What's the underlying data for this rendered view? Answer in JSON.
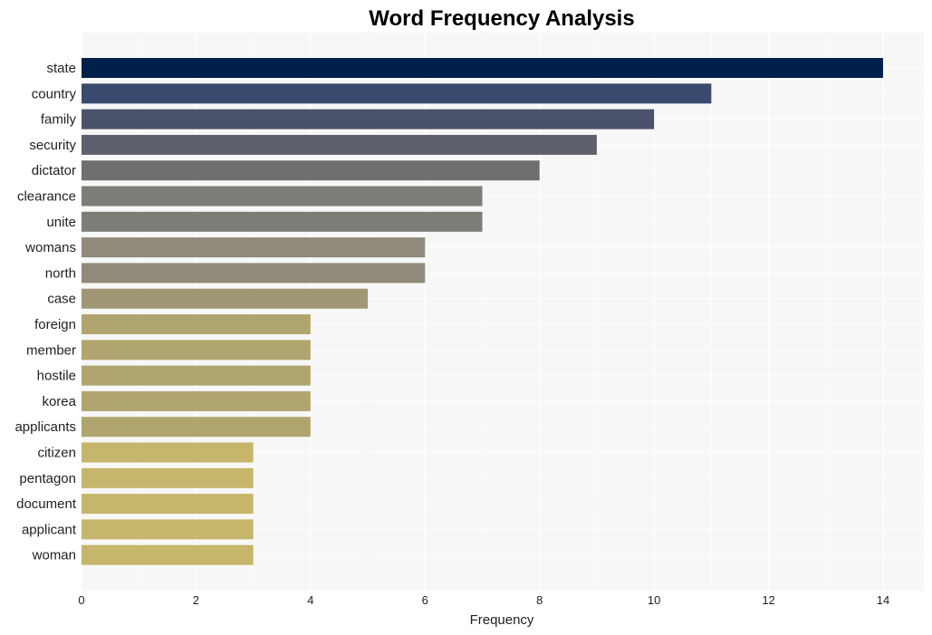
{
  "chart_data": {
    "type": "bar",
    "orientation": "horizontal",
    "title": "Word Frequency Analysis",
    "xlabel": "Frequency",
    "ylabel": "",
    "xlim": [
      0,
      14.7
    ],
    "xticks": [
      0,
      2,
      4,
      6,
      8,
      10,
      12,
      14
    ],
    "grid": true,
    "categories": [
      "state",
      "country",
      "family",
      "security",
      "dictator",
      "clearance",
      "unite",
      "womans",
      "north",
      "case",
      "foreign",
      "member",
      "hostile",
      "korea",
      "applicants",
      "citizen",
      "pentagon",
      "document",
      "applicant",
      "woman"
    ],
    "values": [
      14,
      11,
      10,
      9,
      8,
      7,
      7,
      6,
      6,
      5,
      4,
      4,
      4,
      4,
      4,
      3,
      3,
      3,
      3,
      3
    ],
    "colors": [
      "#00204c",
      "#3a4a6e",
      "#4b526b",
      "#5d616e",
      "#6f6f72",
      "#7e7c76",
      "#7e7c76",
      "#8f8a79",
      "#8f8a79",
      "#a09775",
      "#b1a56f",
      "#b1a56f",
      "#b1a56f",
      "#b1a56f",
      "#b1a56f",
      "#c6b66b",
      "#c6b66b",
      "#c6b66b",
      "#c6b66b",
      "#c6b66b"
    ],
    "background": "#f7f7f7"
  }
}
